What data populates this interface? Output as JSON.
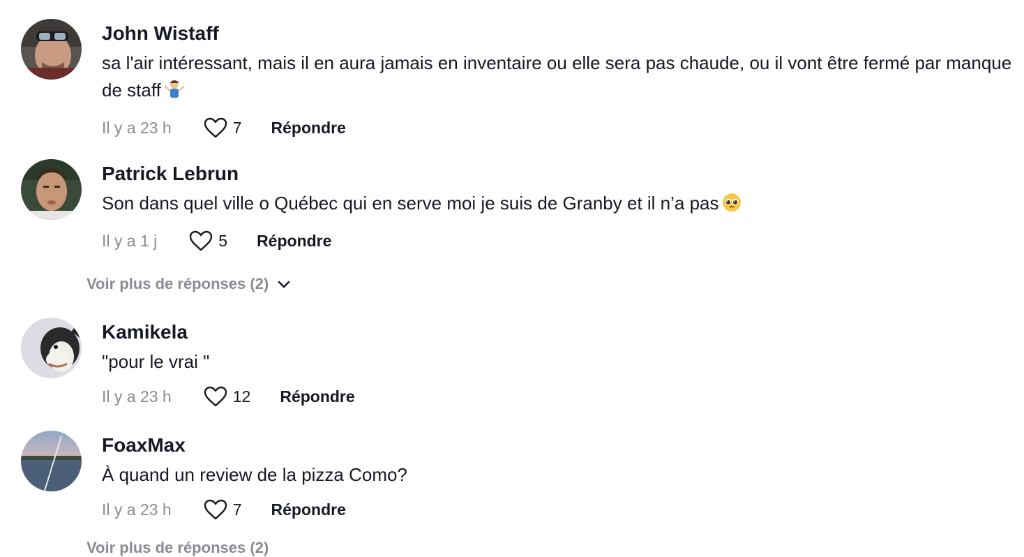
{
  "comments": [
    {
      "username": "John Wistaff",
      "text": "sa l'air intéressant, mais il en aura jamais en inventaire ou elle sera pas chaude, ou il vont être fermé par manque de staff",
      "emoji": "man-shrugging-emoji",
      "time": "Il y a 23 h",
      "likes": "7",
      "reply_label": "Répondre"
    },
    {
      "username": "Patrick Lebrun",
      "text": "Son dans quel ville o Québec qui en serve moi je suis de Granby et il n’a pas",
      "emoji": "pleading-face-emoji",
      "time": "Il y a 1 j",
      "likes": "5",
      "reply_label": "Répondre"
    },
    {
      "username": "Kamikela",
      "text": "\"pour le vrai \"",
      "time": "Il y a 23 h",
      "likes": "12",
      "reply_label": "Répondre"
    },
    {
      "username": "FoaxMax",
      "text": "À quand un review de la pizza Como?",
      "time": "Il y a 23 h",
      "likes": "7",
      "reply_label": "Répondre"
    }
  ],
  "view_more_replies": "Voir plus de réponses (2)",
  "view_more_replies_bottom": "Voir plus de réponses (2)",
  "icons": {
    "like": "heart-outline-icon",
    "expand": "chevron-down-icon"
  },
  "colors": {
    "primary_text": "#161823",
    "secondary_text": "#8a8b91"
  }
}
